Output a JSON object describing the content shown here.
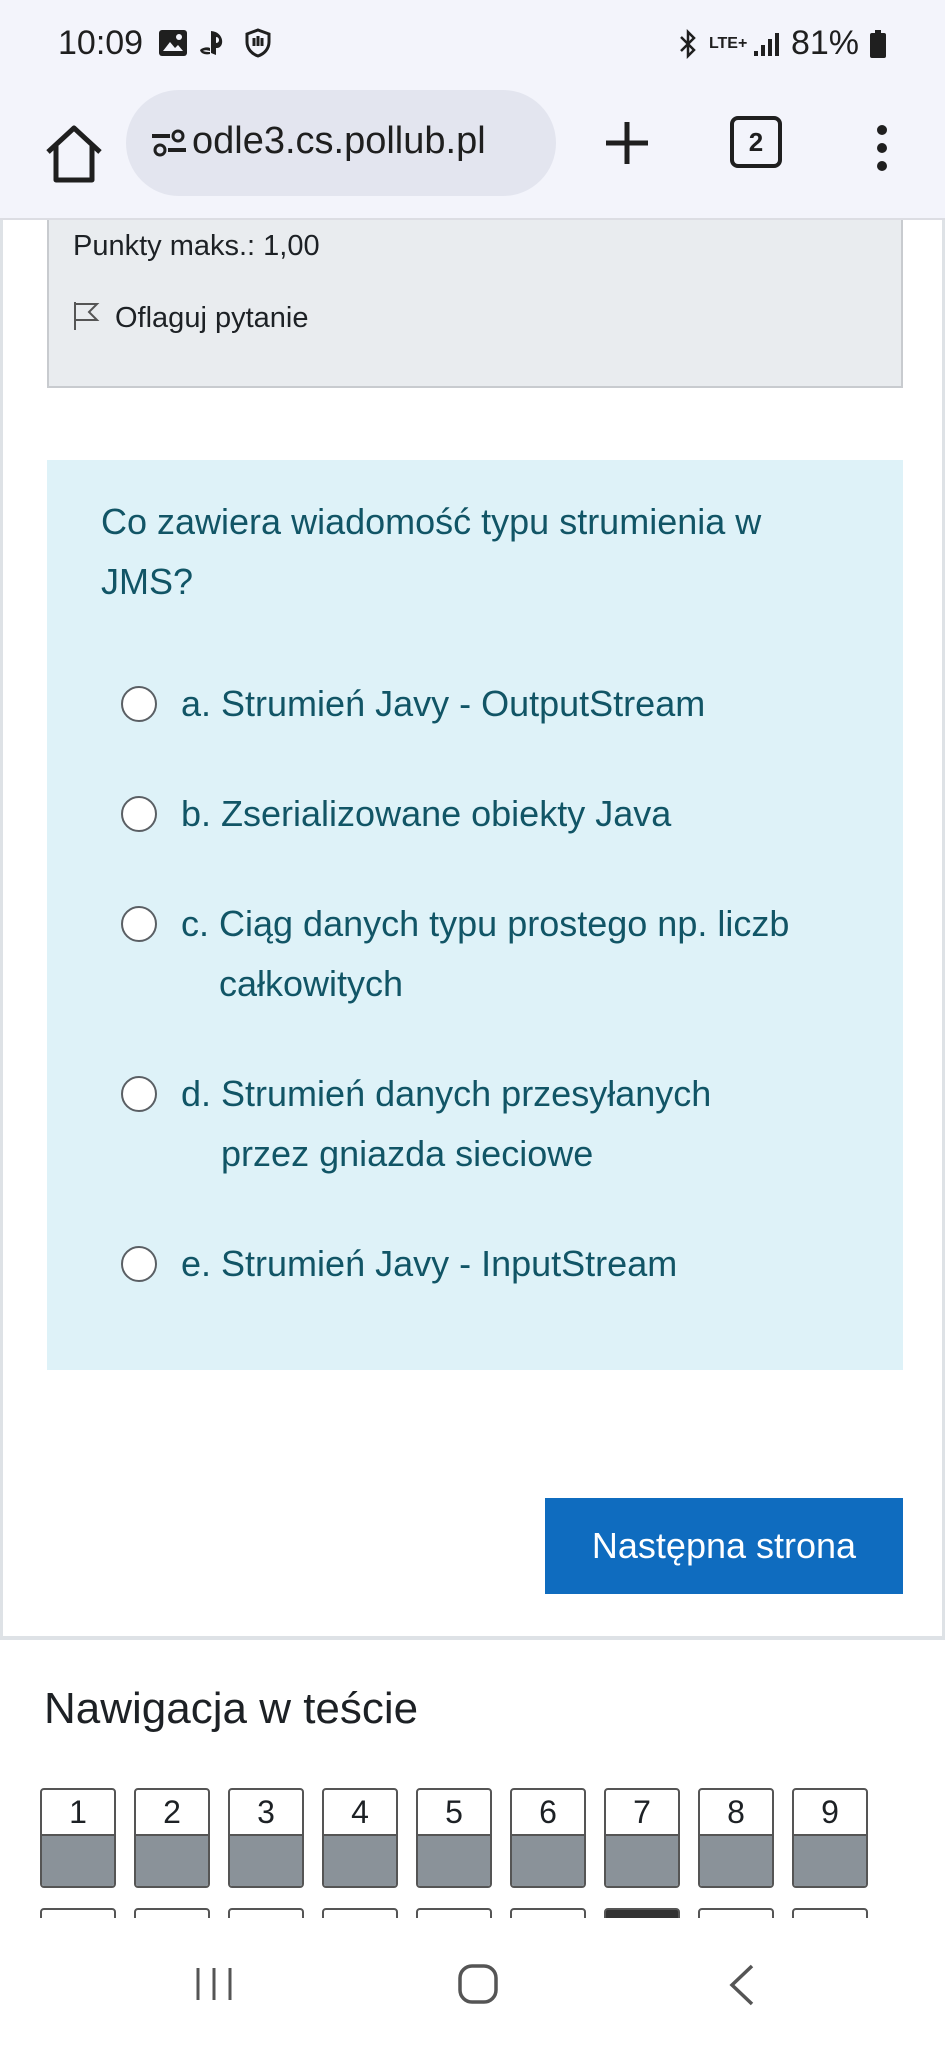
{
  "status_bar": {
    "time": "10:09",
    "network": "LTE+",
    "battery": "81%",
    "icons": [
      "image-icon",
      "playstation-icon",
      "shield-icon",
      "bluetooth-icon",
      "signal-icon",
      "battery-icon"
    ]
  },
  "browser": {
    "url": "odle3.cs.pollub.pl",
    "tab_count": "2",
    "icons": [
      "home-icon",
      "site-settings-icon",
      "plus-icon",
      "tabs-icon",
      "more-vert-icon"
    ]
  },
  "question_info": {
    "points": "Punkty maks.: 1,00",
    "flag_label": "Oflaguj pytanie"
  },
  "question": {
    "text": "Co zawiera wiadomość typu strumienia w JMS?",
    "answers": [
      {
        "letter": "a.",
        "text": "Strumień Javy - OutputStream"
      },
      {
        "letter": "b.",
        "text": "Zserializowane obiekty Java"
      },
      {
        "letter": "c.",
        "text": "Ciąg danych typu prostego np. liczb całkowitych"
      },
      {
        "letter": "d.",
        "text": "Strumień danych przesyłanych przez gniazda sieciowe"
      },
      {
        "letter": "e.",
        "text": "Strumień Javy - InputStream"
      }
    ]
  },
  "next_button": {
    "label": "Następna strona"
  },
  "quiz_nav": {
    "title": "Nawigacja w teście",
    "buttons": [
      "1",
      "2",
      "3",
      "4",
      "5",
      "6",
      "7",
      "8",
      "9"
    ]
  },
  "colors": {
    "accent": "#0f6cbf",
    "question_bg": "#def2f8",
    "question_text": "#115566",
    "info_bg": "#e9ecef"
  }
}
